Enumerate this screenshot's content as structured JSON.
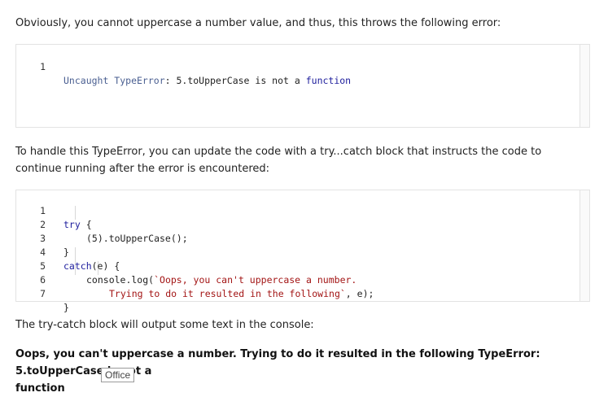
{
  "paragraphs": {
    "p1": "Obviously, you cannot uppercase a number value, and thus, this throws the following error:",
    "p2": "To handle this TypeError, you can update the code with a try...catch block that instructs the code to continue running after the error is encountered:",
    "p3": "The try-catch block will output some text in the console:",
    "p4": "Oops, you can't uppercase a number. Trying to do it resulted in the following TypeError: 5.toUpperCase is not a",
    "p4_last": "function"
  },
  "code_block_1": {
    "lines": [
      {
        "num": "1",
        "t1": "Uncaught TypeError",
        "t2": ": 5.toUpperCase is not a ",
        "t3": "function"
      }
    ]
  },
  "code_block_2": {
    "lines": [
      {
        "num": "1",
        "a": "try",
        "b": " {"
      },
      {
        "num": "2",
        "a": "(5).toUpperCase();"
      },
      {
        "num": "3",
        "a": "}"
      },
      {
        "num": "4",
        "a": "catch",
        "b": "(e) {"
      },
      {
        "num": "5",
        "a": "console.log(",
        "b": "`Oops, you can't uppercase a number."
      },
      {
        "num": "6",
        "a": "Trying to do it resulted in the following`",
        "b": ", e);"
      },
      {
        "num": "7",
        "a": "}"
      }
    ]
  },
  "badge": {
    "label": "Office"
  },
  "colors": {
    "keyword": "#1c1c9c",
    "string": "#a31515",
    "border": "#e3e3e3"
  }
}
